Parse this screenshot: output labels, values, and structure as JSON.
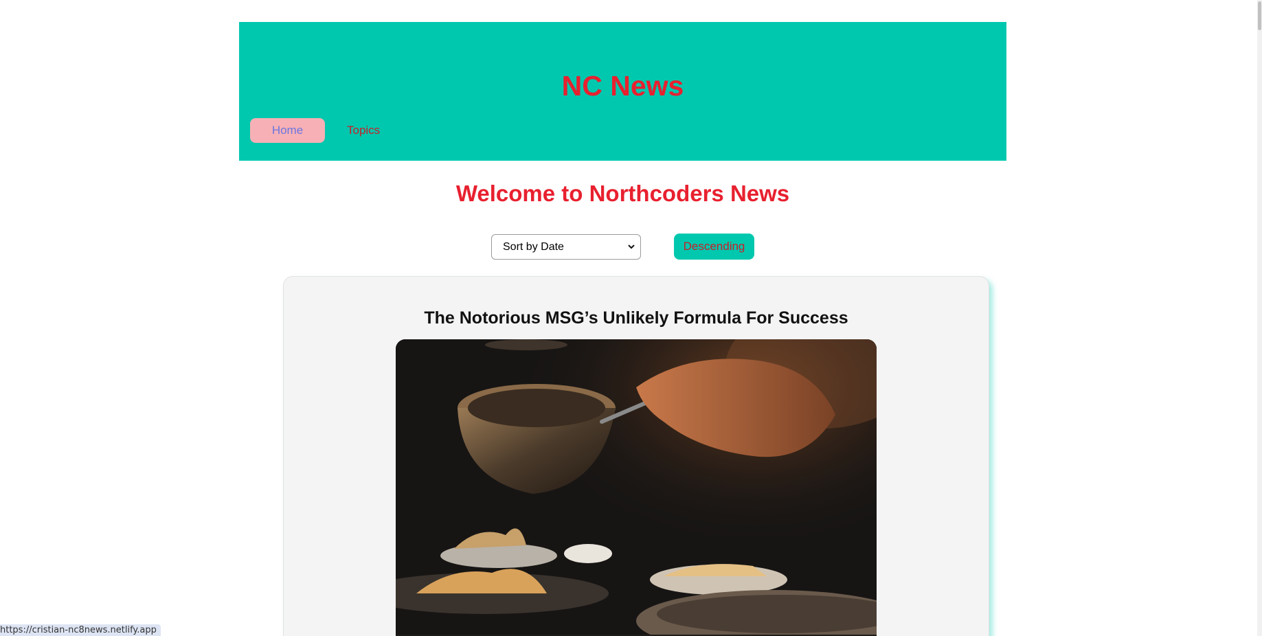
{
  "header": {
    "title": "NC News",
    "nav": {
      "home_label": "Home",
      "topics_label": "Topics"
    }
  },
  "main": {
    "welcome_heading": "Welcome to Northcoders News",
    "sort": {
      "selected": "Sort by Date"
    },
    "order_button_label": "Descending"
  },
  "article": {
    "title": "The Notorious MSG’s Unlikely Formula For Success"
  },
  "status_bar": {
    "url": "https://cristian-nc8news.netlify.app"
  },
  "colors": {
    "header_bg": "#00c8ae",
    "title_red": "#e8202f",
    "home_pill": "#f7b0b5",
    "link_red": "#c8202a"
  }
}
